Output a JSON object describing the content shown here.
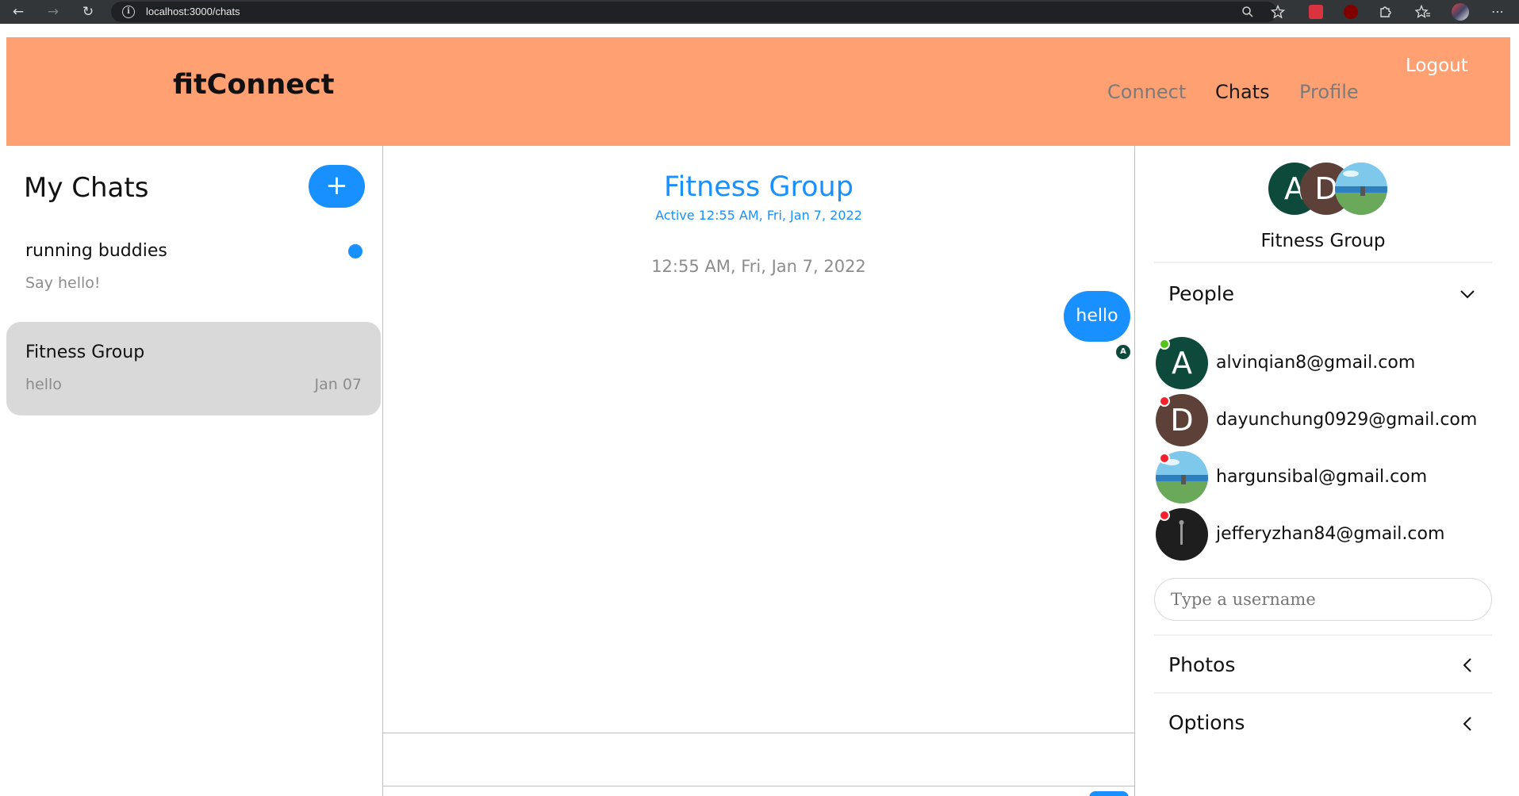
{
  "browser": {
    "url": "localhost:3000/chats"
  },
  "header": {
    "brand": "fitConnect",
    "nav": [
      "Connect",
      "Chats",
      "Profile"
    ],
    "active_nav": "Chats",
    "logout": "Logout",
    "bg_color": "#ffa073"
  },
  "chat_list": {
    "title": "My Chats",
    "new_chat_label": "+",
    "chats": [
      {
        "title": "running buddies",
        "last_message": "Say hello!",
        "date": "",
        "unread": true
      },
      {
        "title": "Fitness Group",
        "last_message": "hello",
        "date": "Jan 07",
        "unread": false,
        "selected": true
      }
    ]
  },
  "feed": {
    "title": "Fitness Group",
    "active_status": "Active 12:55 AM, Fri, Jan 7, 2022",
    "timestamp": "12:55 AM, Fri, Jan 7, 2022",
    "messages": [
      {
        "text": "hello",
        "mine": true,
        "read_by_initial": "A"
      }
    ],
    "accent_color": "#1890ff"
  },
  "settings": {
    "group_name": "Fitness Group",
    "group_avatar_initials": [
      "A",
      "D"
    ],
    "people_title": "People",
    "people": [
      {
        "initial": "A",
        "email": "alvinqian8@gmail.com",
        "online": true,
        "color": "#0d4a3c"
      },
      {
        "initial": "D",
        "email": "dayunchung0929@gmail.com",
        "online": false,
        "color": "#5d4037"
      },
      {
        "initial": "",
        "email": "hargunsibal@gmail.com",
        "online": false,
        "color": "#87c5e8"
      },
      {
        "initial": "",
        "email": "jefferyzhan84@gmail.com",
        "online": false,
        "color": "#1e1e1e"
      }
    ],
    "username_placeholder": "Type a username",
    "photos_title": "Photos",
    "options_title": "Options",
    "online_color": "#52c41a",
    "offline_color": "#f5222d"
  }
}
